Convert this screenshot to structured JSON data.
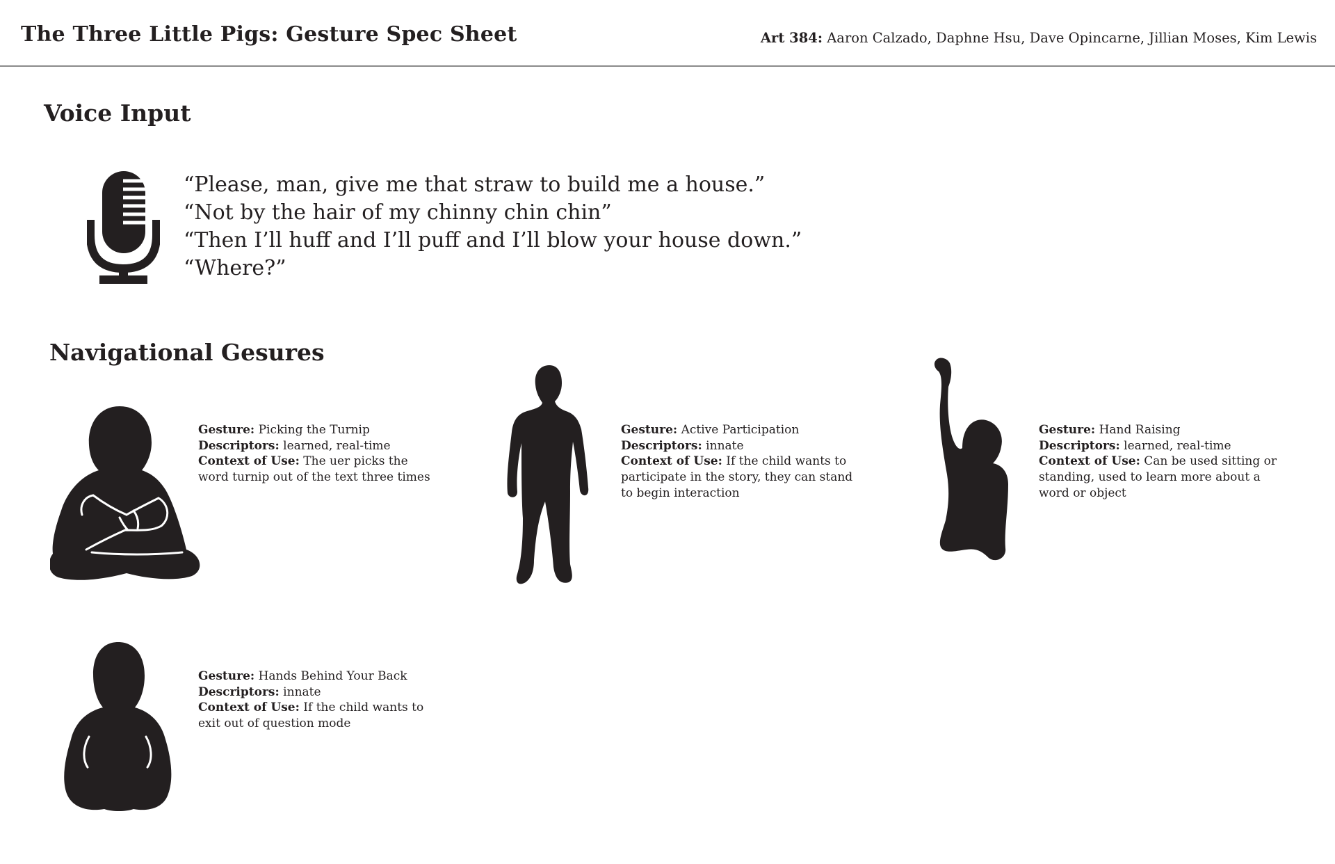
{
  "header": {
    "title": "The Three Little Pigs: Gesture Spec Sheet",
    "course_label": "Art 384:",
    "authors": " Aaron Calzado, Daphne Hsu, Dave Opincarne, Jillian Moses, Kim Lewis"
  },
  "voice_input": {
    "heading": "Voice Input",
    "icon": "microphone-icon",
    "quotes": [
      "“Please, man, give me that straw to build me a house.”",
      "“Not by the hair of my chinny chin chin”",
      "“Then I’ll huff and I’ll puff and I’ll blow your house down.”",
      "“Where?”"
    ]
  },
  "navigational_gestures": {
    "heading": "Navigational Gesures",
    "labels": {
      "gesture": "Gesture:",
      "descriptors": "Descriptors:",
      "context": "Context of Use:"
    },
    "items": [
      {
        "icon": "seated-child-silhouette",
        "gesture": " Picking the Turnip",
        "descriptors": " learned, real-time",
        "context": " The uer picks the word turnip out of the text three times"
      },
      {
        "icon": "standing-child-silhouette",
        "gesture": " Active Participation",
        "descriptors": " innate",
        "context": " If the child wants to participate in the story, they can stand to begin interaction"
      },
      {
        "icon": "hand-raising-silhouette",
        "gesture": " Hand Raising",
        "descriptors": " learned, real-time",
        "context": " Can be used sitting or standing, used to learn more about a word or object"
      },
      {
        "icon": "hands-behind-back-silhouette",
        "gesture": " Hands Behind Your Back",
        "descriptors": " innate",
        "context": " If the child wants to exit out of question mode"
      }
    ]
  }
}
